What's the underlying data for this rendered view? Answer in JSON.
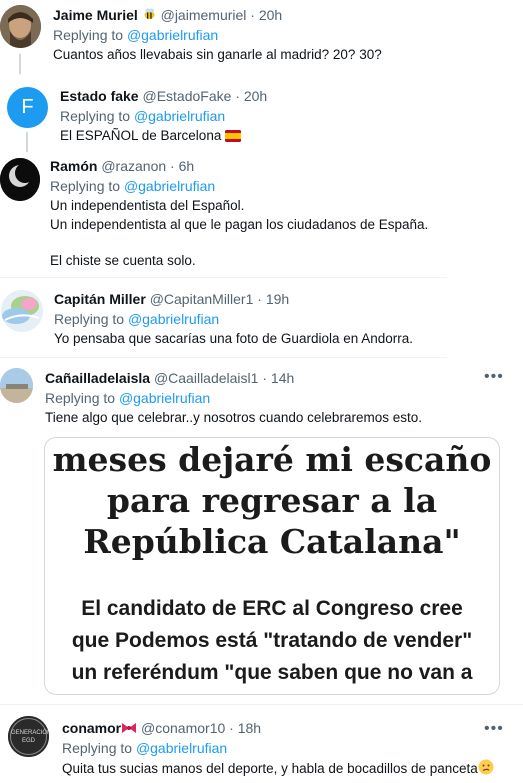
{
  "replies": [
    {
      "name": "Jaime Muriel",
      "name_emoji": "bee-icon",
      "handle": "@jaimemuriel",
      "time": "20h",
      "replying_prefix": "Replying to ",
      "mention": "@gabrielrufian",
      "lines": [
        "Cuantos años llevabais sin ganarle al madrid? 20? 30?"
      ]
    },
    {
      "name": "Estado fake",
      "handle": "@EstadoFake",
      "time": "20h",
      "avatar_letter": "F",
      "replying_prefix": "Replying to ",
      "mention": "@gabrielrufian",
      "lines": [
        "El ESPAÑOL de Barcelona"
      ],
      "line_emoji": "spain-flag-icon"
    },
    {
      "name": "Ramón",
      "handle": "@razanon",
      "time": "6h",
      "replying_prefix": "Replying to ",
      "mention": "@gabrielrufian",
      "lines": [
        "Un independentista del Español.",
        "Un independentista al que le pagan los ciudadanos de España.",
        "El chiste se cuenta solo."
      ]
    },
    {
      "name": "Capitán Miller",
      "handle": "@CapitanMiller1",
      "time": "19h",
      "replying_prefix": "Replying to ",
      "mention": "@gabrielrufian",
      "lines": [
        "Yo pensaba que sacarías una foto de Guardiola en Andorra."
      ]
    },
    {
      "name": "Cañailladelaisla",
      "handle": "@Caailladelaisl1",
      "time": "14h",
      "replying_prefix": "Replying to ",
      "mention": "@gabrielrufian",
      "lines": [
        "Tiene  algo que celebrar..y nosotros cuando celebraremos esto."
      ],
      "more": "•••",
      "image": {
        "headline_lines": [
          "meses dejaré mi escaño",
          "para regresar a la",
          "República Catalana\""
        ],
        "body_lines": [
          "El candidato de ERC al Congreso cree",
          "que Podemos está \"tratando de vender\"",
          "un referéndum \"que saben que no van a"
        ]
      }
    },
    {
      "name": "conamor",
      "name_emoji": "bow-icon",
      "handle": "@conamor10",
      "time": "18h",
      "avatar_text": "GENERACIÓN EGD",
      "replying_prefix": "Replying to ",
      "mention": "@gabrielrufian",
      "lines": [
        "Quita tus sucias manos del deporte, y habla de bocadillos de panceta"
      ],
      "line_emoji": "confused-face-icon",
      "more": "•••"
    }
  ],
  "separator_dot": " · ",
  "colors": {
    "text": "#0f1419",
    "secondary": "#536471",
    "link": "#1d9bf0",
    "border": "#eff3f4"
  }
}
